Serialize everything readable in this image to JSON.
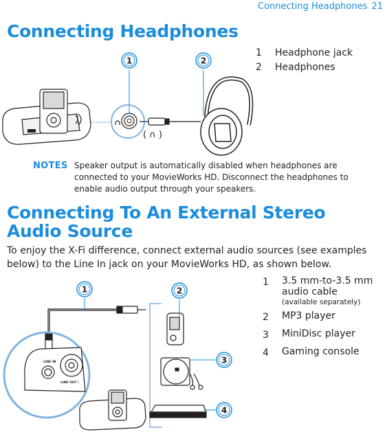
{
  "running_header": {
    "title": "Connecting Headphones",
    "page": "21"
  },
  "section1": {
    "title": "Connecting Headphones",
    "legend": [
      {
        "num": "1",
        "label": "Headphone jack"
      },
      {
        "num": "2",
        "label": "Headphones"
      }
    ],
    "figure": {
      "callouts": [
        "1",
        "2"
      ],
      "headphone_symbol": "( ∩ )"
    },
    "notes": {
      "label": "NOTES",
      "text": "Speaker output is automatically disabled when headphones are connected to your MovieWorks HD. Disconnect the headphones to enable audio output through your speakers."
    }
  },
  "section2": {
    "title": "Connecting To An External Stereo Audio Source",
    "intro": "To enjoy the X-Fi difference, connect external audio sources (see examples below) to the Line In jack on your MovieWorks HD, as shown below.",
    "legend": [
      {
        "num": "1",
        "label": "3.5 mm-to-3.5 mm audio cable",
        "sub": "(available separately)"
      },
      {
        "num": "2",
        "label": "MP3 player"
      },
      {
        "num": "3",
        "label": "MiniDisc player"
      },
      {
        "num": "4",
        "label": "Gaming console"
      }
    ],
    "figure": {
      "callouts": [
        "1",
        "2",
        "3",
        "4"
      ],
      "jack_labels": {
        "line_in": "LINE IN",
        "line_out": "LINE OUT /"
      }
    }
  },
  "colors": {
    "accent": "#1a8cdb",
    "text": "#231f20",
    "circle": "#7fb3e0"
  }
}
